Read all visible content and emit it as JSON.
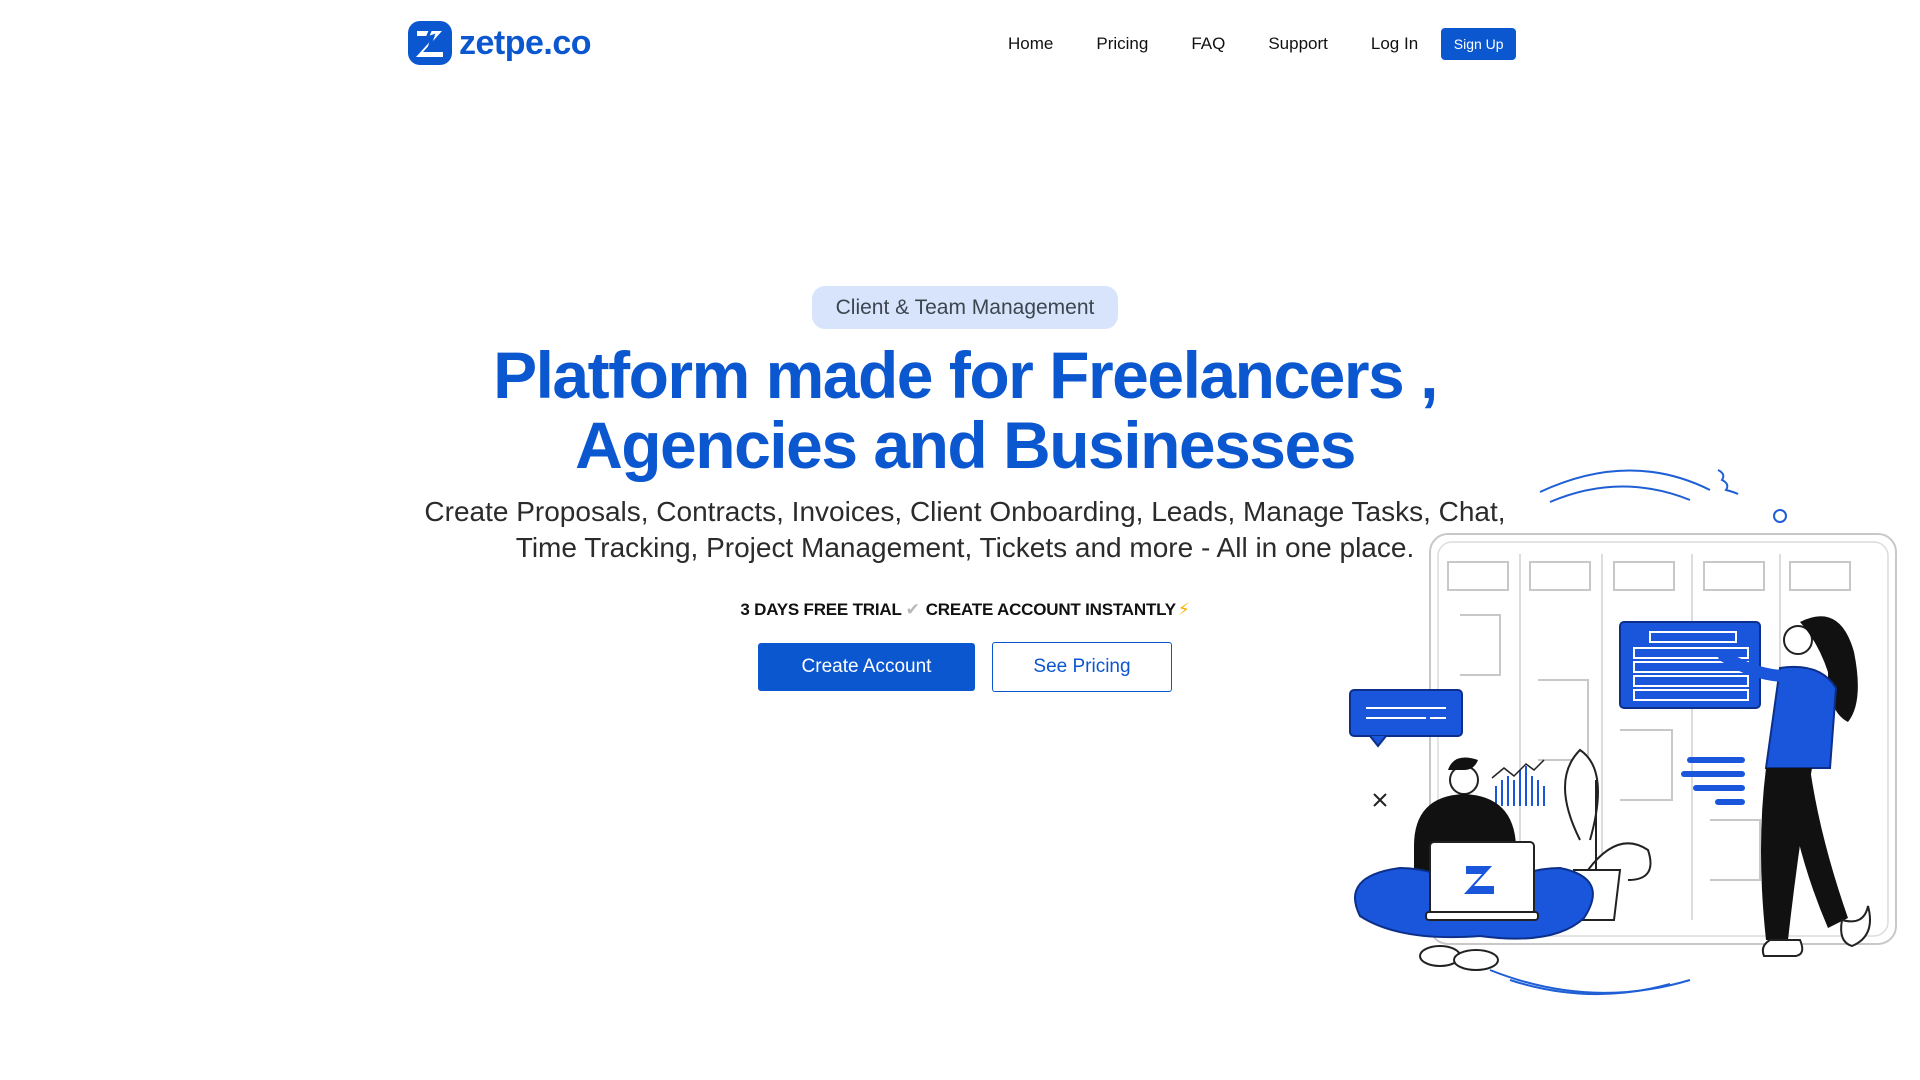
{
  "brand": {
    "name": "zetpe.co",
    "logo_icon": "z-bolt-logo-icon",
    "primary_color": "#0b57d0"
  },
  "nav": {
    "items": [
      {
        "label": "Home"
      },
      {
        "label": "Pricing"
      },
      {
        "label": "FAQ"
      },
      {
        "label": "Support"
      },
      {
        "label": "Log In"
      }
    ],
    "signup_label": "Sign Up"
  },
  "hero": {
    "tag": "Client & Team Management",
    "title_line1": "Platform made for Freelancers ,",
    "title_line2": "Agencies and Businesses",
    "subtitle_line1": "Create Proposals, Contracts, Invoices, Client Onboarding, Leads, Manage Tasks, Chat,",
    "subtitle_line2": "Time Tracking, Project Management, Tickets and more - All in one place.",
    "trial_text": "3 DAYS FREE TRIAL",
    "trial_check_icon": "check-mark-icon",
    "instant_text": "CREATE ACCOUNT INSTANTLY",
    "instant_icon": "lightning-icon",
    "primary_cta": "Create Account",
    "secondary_cta": "See Pricing"
  },
  "illustration": {
    "description_icon": "team-kanban-illustration"
  }
}
